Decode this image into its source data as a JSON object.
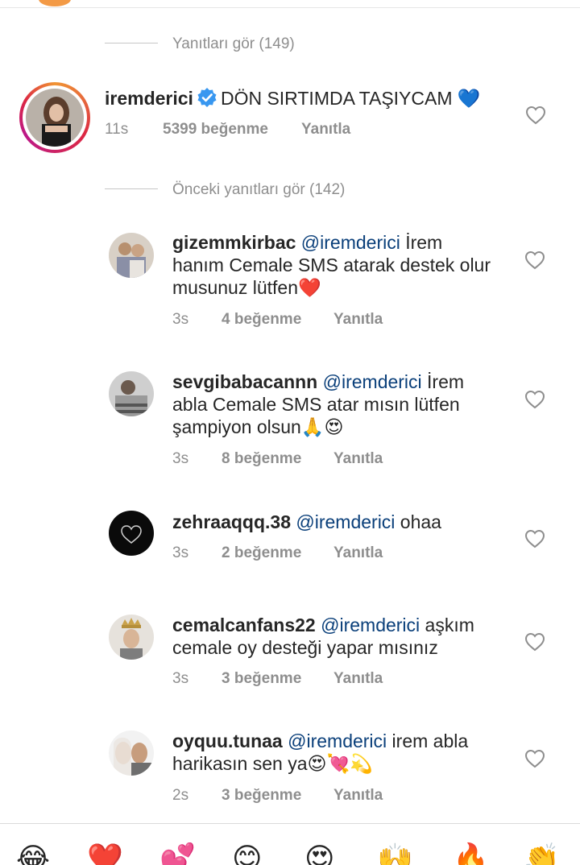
{
  "thread": {
    "view_replies": "Yanıtları gör (149)",
    "previous_replies": "Önceki yanıtları gör (142)"
  },
  "main_comment": {
    "username": "iremderici",
    "text": "DÖN SIRTIMDA TAŞIYCAM 💙",
    "time": "11s",
    "likes": "5399 beğenme",
    "reply": "Yanıtla",
    "verified": true
  },
  "replies": [
    {
      "username": "gizemmkirbac",
      "mention": "@iremderici",
      "text_line1": " İrem",
      "text_line2": "hanım Cemale SMS atarak destek olur",
      "text_line3": "musunuz lütfen❤️",
      "time": "3s",
      "likes": "4 beğenme",
      "reply": "Yanıtla"
    },
    {
      "username": "sevgibabacannn",
      "mention": "@iremderici",
      "text_line1": " İrem",
      "text_line2": "abla Cemale SMS atar mısın lütfen",
      "text_line3": "şampiyon olsun🙏😍",
      "time": "3s",
      "likes": "8 beğenme",
      "reply": "Yanıtla"
    },
    {
      "username": "zehraaqqq.38",
      "mention": "@iremderici",
      "text_line1": " ohaa",
      "time": "3s",
      "likes": "2 beğenme",
      "reply": "Yanıtla"
    },
    {
      "username": "cemalcanfans22",
      "mention": "@iremderici",
      "text_line1": " aşkım",
      "text_line2": "cemale oy desteği yapar mısınız",
      "time": "3s",
      "likes": "3 beğenme",
      "reply": "Yanıtla"
    },
    {
      "username": "oyquu.tunaa",
      "mention": "@iremderici",
      "text_line1": " irem abla",
      "text_line2": "harikasın sen ya😍💘💫",
      "time": "2s",
      "likes": "3 beğenme",
      "reply": "Yanıtla"
    }
  ],
  "emoji_bar": [
    "😂",
    "❤️",
    "💕",
    "😊",
    "😍",
    "🙌",
    "🔥",
    "👏"
  ],
  "colors": {
    "mention": "#0a3f7a",
    "verified": "#3897f0",
    "meta": "#8e8e8e"
  }
}
